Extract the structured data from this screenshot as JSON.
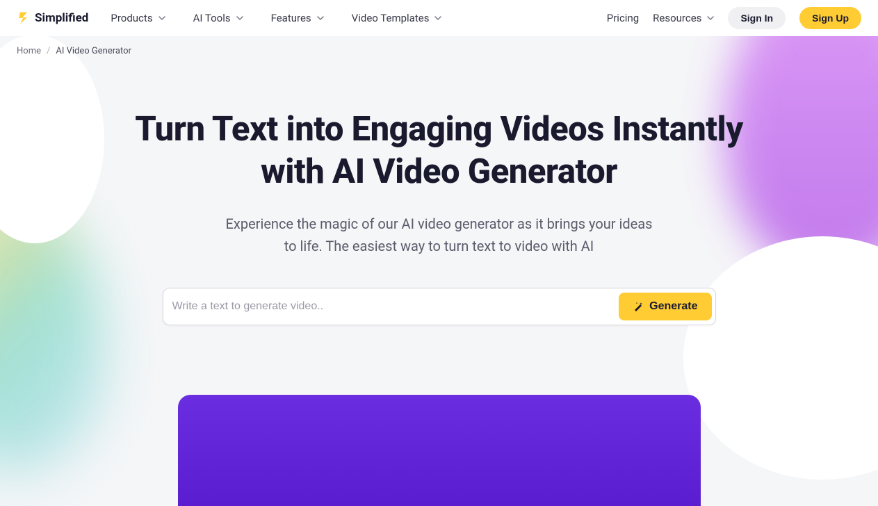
{
  "logo": {
    "text": "Simplified"
  },
  "nav": {
    "items": [
      {
        "label": "Products"
      },
      {
        "label": "AI Tools"
      },
      {
        "label": "Features"
      },
      {
        "label": "Video Templates"
      }
    ],
    "right": {
      "pricing": "Pricing",
      "resources": "Resources",
      "signin": "Sign In",
      "signup": "Sign Up"
    }
  },
  "breadcrumb": {
    "home": "Home",
    "current": "AI Video Generator"
  },
  "hero": {
    "title": "Turn Text into Engaging Videos Instantly with AI Video Generator",
    "subtitle": "Experience the magic of our AI video generator as it brings your ideas to life. The easiest way to turn text to video with AI",
    "placeholder": "Write a text to generate video..",
    "generate_label": "Generate"
  }
}
